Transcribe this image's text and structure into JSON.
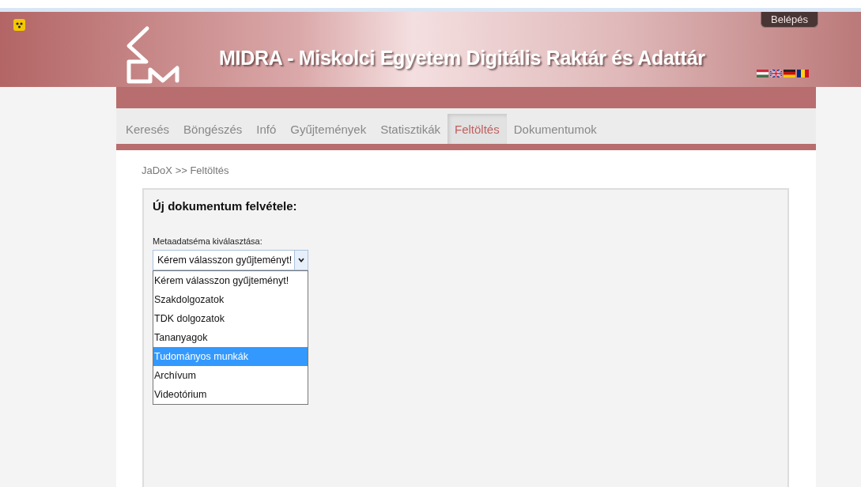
{
  "header": {
    "title": "MIDRA - Miskolci Egyetem Digitális Raktár és Adattár",
    "login_button": "Belépés",
    "languages": [
      {
        "kind": "hu"
      },
      {
        "kind": "en"
      },
      {
        "kind": "de"
      },
      {
        "kind": "ro"
      }
    ]
  },
  "tabs": [
    {
      "label": "Keresés",
      "selected": false
    },
    {
      "label": "Böngészés",
      "selected": false
    },
    {
      "label": "Infó",
      "selected": false
    },
    {
      "label": "Gyűjtemények",
      "selected": false
    },
    {
      "label": "Statisztikák",
      "selected": false
    },
    {
      "label": "Feltöltés",
      "selected": true
    },
    {
      "label": "Dokumentumok",
      "selected": false
    }
  ],
  "breadcrumb": "JaDoX >> Feltöltés",
  "form": {
    "heading": "Új dokumentum felvétele:",
    "field_label": "Metaadatséma kiválasztása:",
    "select_value": "Kérem válasszon gyűjteményt!",
    "options": [
      {
        "label": "Kérem válasszon gyűjteményt!",
        "selected": false
      },
      {
        "label": "Szakdolgozatok",
        "selected": false
      },
      {
        "label": "TDK dolgozatok",
        "selected": false
      },
      {
        "label": "Tananyagok",
        "selected": false
      },
      {
        "label": "Tudományos munkák",
        "selected": true
      },
      {
        "label": "Archívum",
        "selected": false
      },
      {
        "label": "Videotórium",
        "selected": false
      }
    ]
  }
}
